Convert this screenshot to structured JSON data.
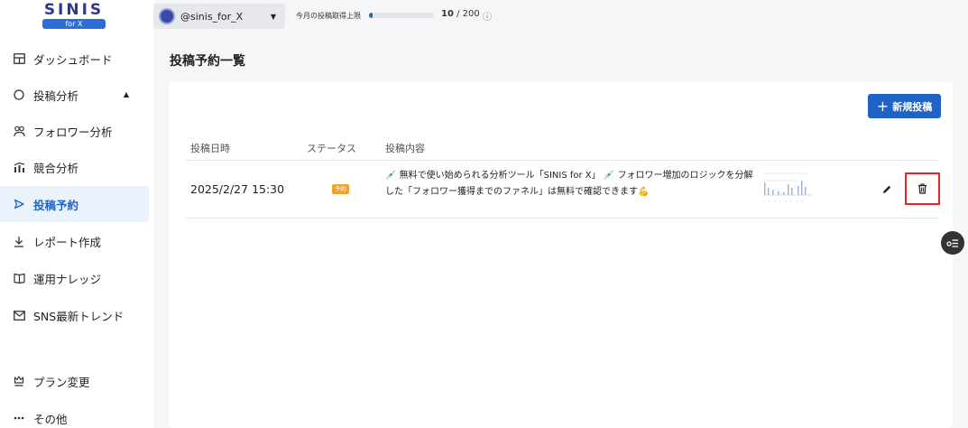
{
  "logo": {
    "text": "SINIS",
    "sub": "for X"
  },
  "sidebar": {
    "items": [
      {
        "label": "ダッシュボード",
        "icon": "dashboard-icon"
      },
      {
        "label": "投稿分析",
        "icon": "circle-icon"
      },
      {
        "label": "フォロワー分析",
        "icon": "users-icon"
      },
      {
        "label": "競合分析",
        "icon": "competitor-chart-icon"
      },
      {
        "label": "投稿予約",
        "icon": "send-icon"
      },
      {
        "label": "レポート作成",
        "icon": "download-icon"
      },
      {
        "label": "運用ナレッジ",
        "icon": "book-icon"
      },
      {
        "label": "SNS最新トレンド",
        "icon": "mail-icon"
      },
      {
        "label": "プラン変更",
        "icon": "crown-icon"
      },
      {
        "label": "その他",
        "icon": "more-icon"
      }
    ],
    "active_index": 4,
    "expanded_caret": "▲"
  },
  "topbar": {
    "account": "@sinis_for_X",
    "dropdown_caret": "▼",
    "quota_label": "今月の投稿取得上限",
    "quota_used": "10",
    "quota_sep": " / ",
    "quota_total": "200",
    "quota_fraction": 0.05,
    "info_icon": "ⓘ"
  },
  "main": {
    "title": "投稿予約一覧",
    "new_button": {
      "plus": "+",
      "label": "新規投稿"
    },
    "table": {
      "headers": [
        "投稿日時",
        "ステータス",
        "投稿内容"
      ],
      "rows": [
        {
          "date": "2025/2/27 15:30",
          "status": "予約",
          "content": "💉 無料で使い始められる分析ツール「SINIS for X」 💉 フォロワー増加のロジックを分解した「フォロワー獲得までのファネル」は無料で確認できます💪"
        }
      ]
    }
  },
  "colors": {
    "accent": "#1f63c6",
    "badge": "#f0a12a",
    "highlight": "#e5262b",
    "active_bg": "#eaf2fc"
  }
}
